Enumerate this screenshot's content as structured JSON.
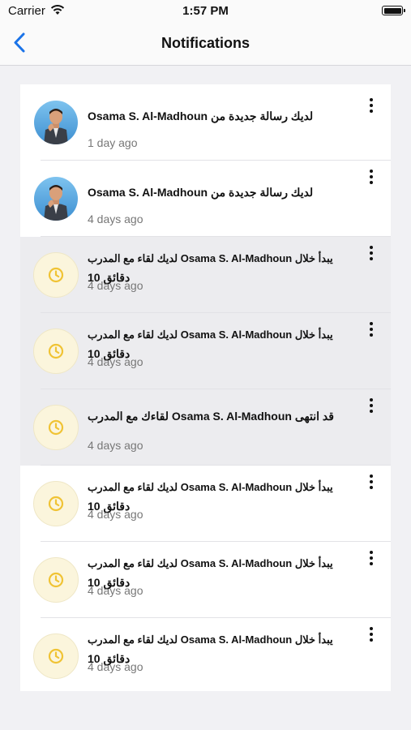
{
  "status_bar": {
    "carrier": "Carrier",
    "time": "1:57 PM"
  },
  "nav": {
    "title": "Notifications",
    "back_icon": "chevron-left-icon"
  },
  "colors": {
    "accent": "#1a73e8",
    "highlight_row": "#ececef",
    "clock_yellow": "#f0c334"
  },
  "notifications": [
    {
      "type": "message",
      "line1": "Osama S. Al-Madhoun  لديك رسالة جديدة من",
      "line2": "",
      "time": "1 day ago",
      "highlighted": false
    },
    {
      "type": "message",
      "line1": "Osama S. Al-Madhoun  لديك رسالة جديدة من",
      "line2": "",
      "time": "4 days ago",
      "highlighted": false
    },
    {
      "type": "meeting",
      "line1": "لديك لقاء مع المدرب  Osama S. Al-Madhoun يبدأ خلال",
      "line2": "10 دقائق",
      "time": "4 days ago",
      "highlighted": true
    },
    {
      "type": "meeting",
      "line1": "لديك لقاء مع المدرب  Osama S. Al-Madhoun يبدأ خلال",
      "line2": "10 دقائق",
      "time": "4 days ago",
      "highlighted": true
    },
    {
      "type": "meeting",
      "line1": "لقاءك مع المدرب  Osama S. Al-Madhoun قد انتهى",
      "line2": "",
      "time": "4 days ago",
      "highlighted": true
    },
    {
      "type": "meeting",
      "line1": "لديك لقاء مع المدرب  Osama S. Al-Madhoun يبدأ خلال",
      "line2": "10 دقائق",
      "time": "4 days ago",
      "highlighted": false
    },
    {
      "type": "meeting",
      "line1": "لديك لقاء مع المدرب  Osama S. Al-Madhoun يبدأ خلال",
      "line2": "10 دقائق",
      "time": "4 days ago",
      "highlighted": false
    },
    {
      "type": "meeting",
      "line1": "لديك لقاء مع المدرب  Osama S. Al-Madhoun يبدأ خلال",
      "line2": "10 دقائق",
      "time": "4 days ago",
      "highlighted": false
    }
  ]
}
